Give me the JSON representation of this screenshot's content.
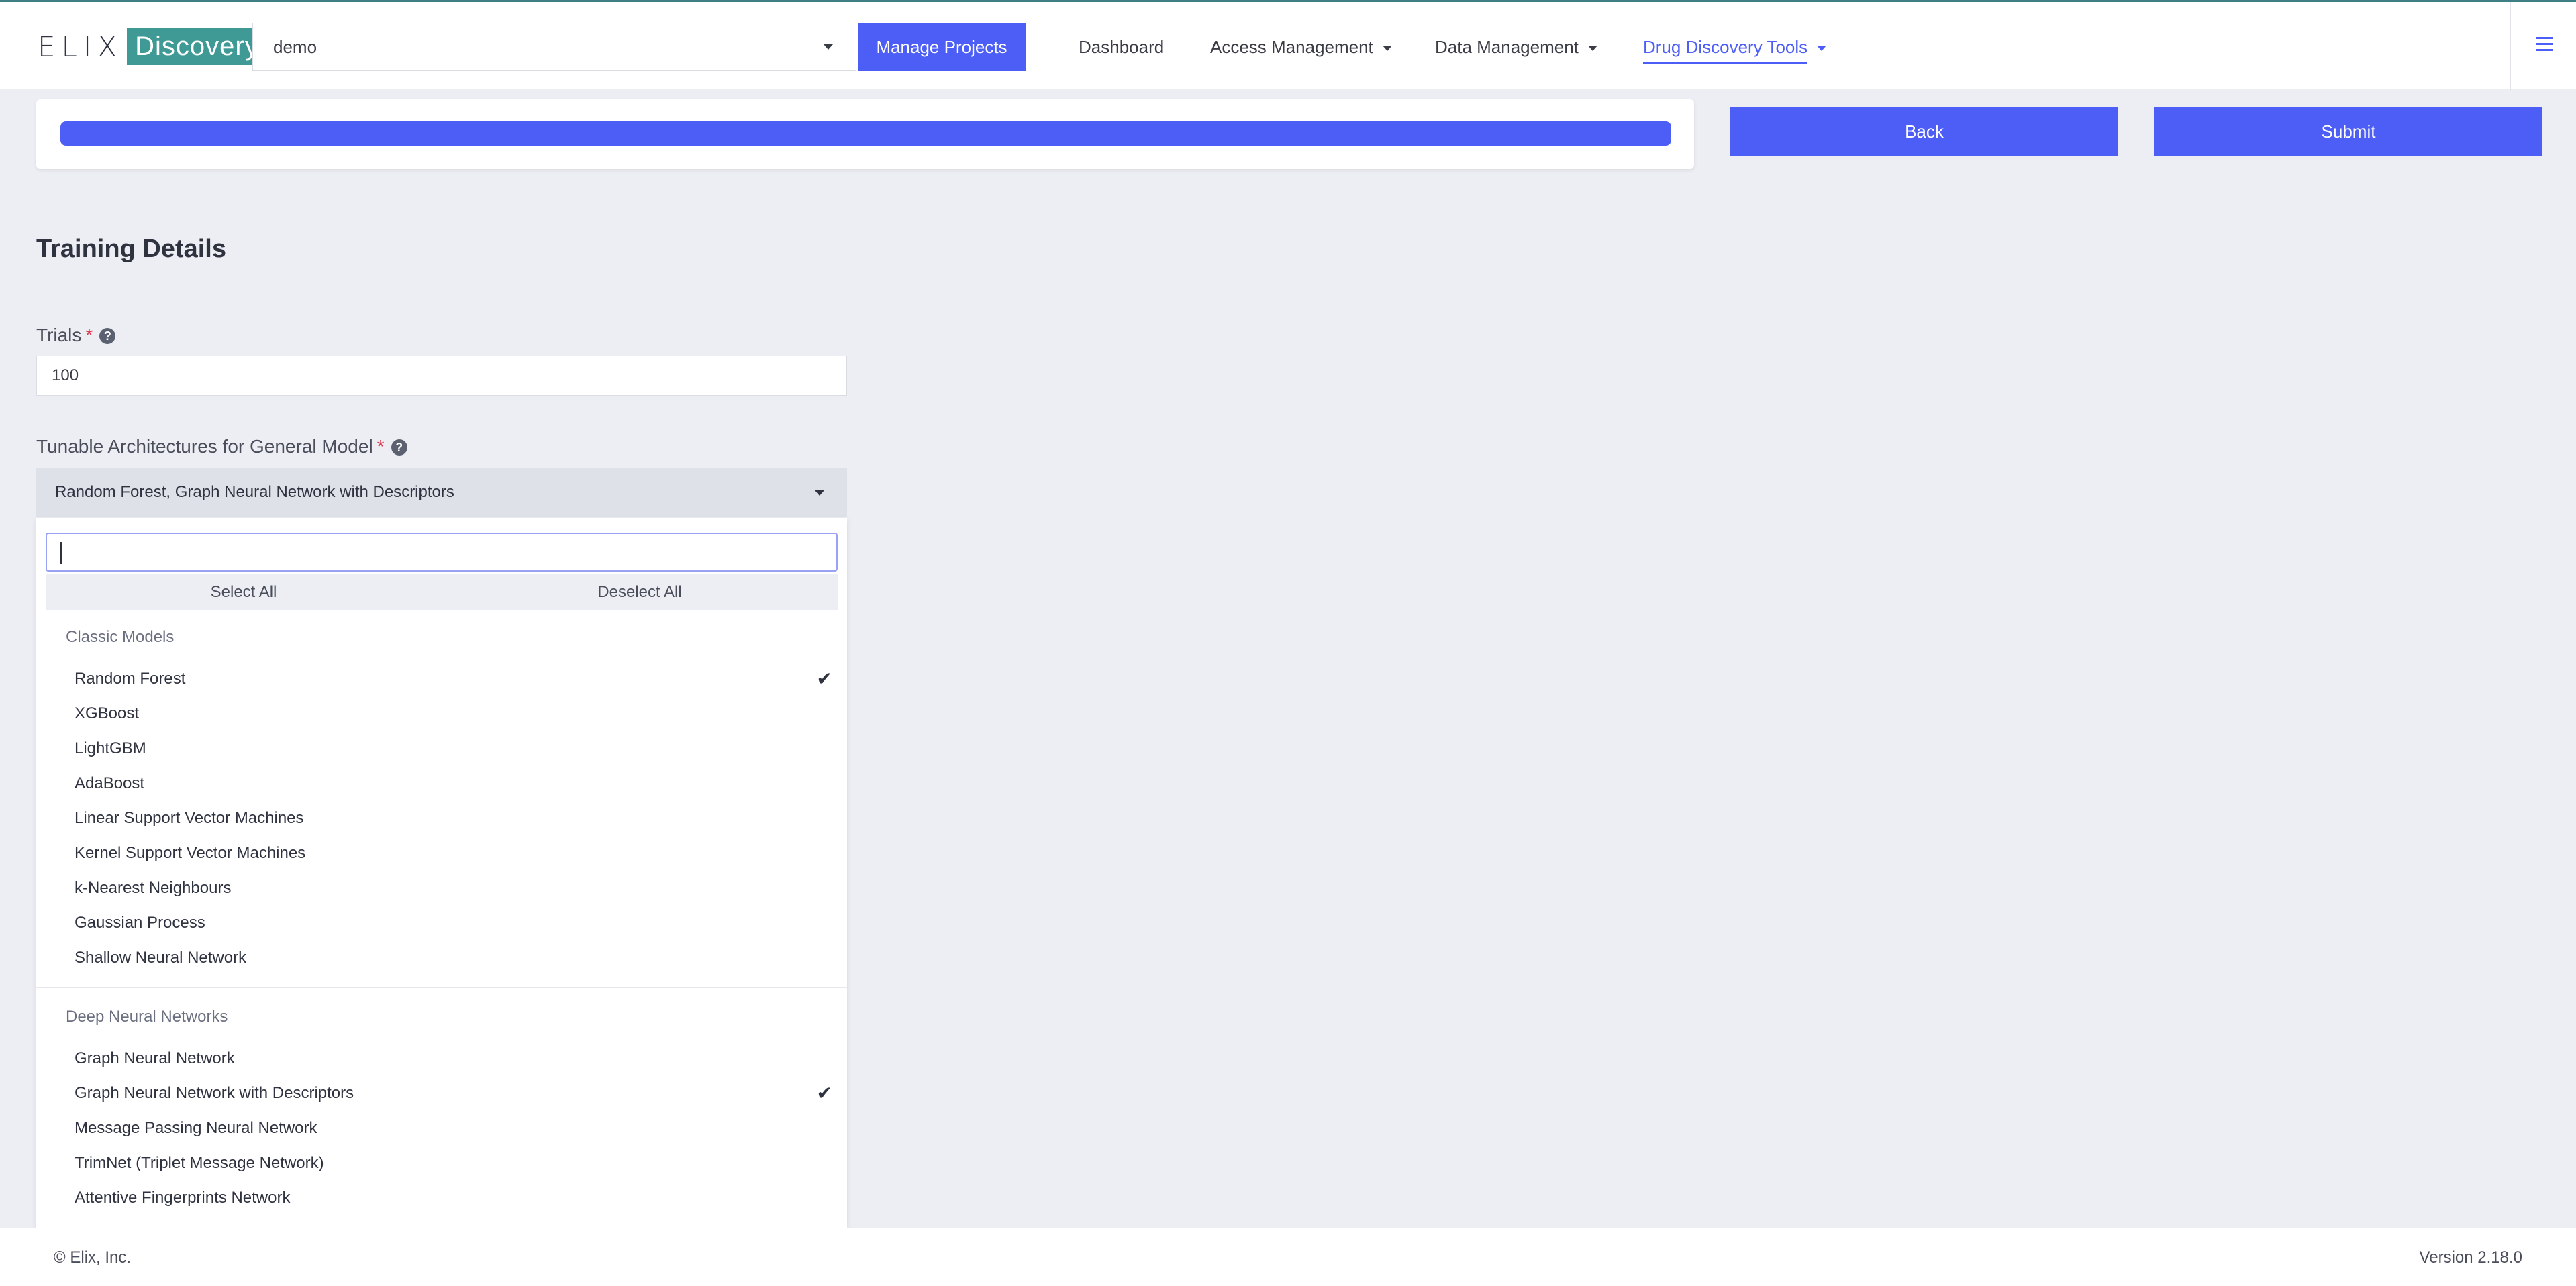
{
  "brand": {
    "name_part1": "ELIX",
    "name_part2": "Discovery",
    "mark": "®"
  },
  "header": {
    "project_value": "demo",
    "manage_projects": "Manage Projects",
    "nav": [
      {
        "label": "Dashboard"
      },
      {
        "label": "Access Management"
      },
      {
        "label": "Data Management"
      },
      {
        "label": "Drug Discovery Tools"
      }
    ]
  },
  "progress": {
    "percent": 100
  },
  "actions": {
    "back": "Back",
    "submit": "Submit"
  },
  "form": {
    "section_title": "Training Details",
    "trials": {
      "label": "Trials",
      "required_mark": "*",
      "help": "?",
      "value": "100"
    },
    "architectures": {
      "label": "Tunable Architectures for General Model",
      "required_mark": "*",
      "help": "?",
      "value": "Random Forest, Graph Neural Network with Descriptors"
    }
  },
  "dropdown": {
    "search_value": "",
    "select_all": "Select All",
    "deselect_all": "Deselect All",
    "check_glyph": "✔",
    "groups": [
      {
        "label": "Classic Models",
        "options": [
          {
            "label": "Random Forest",
            "selected": true
          },
          {
            "label": "XGBoost",
            "selected": false
          },
          {
            "label": "LightGBM",
            "selected": false
          },
          {
            "label": "AdaBoost",
            "selected": false
          },
          {
            "label": "Linear Support Vector Machines",
            "selected": false
          },
          {
            "label": "Kernel Support Vector Machines",
            "selected": false
          },
          {
            "label": "k-Nearest Neighbours",
            "selected": false
          },
          {
            "label": "Gaussian Process",
            "selected": false
          },
          {
            "label": "Shallow Neural Network",
            "selected": false
          }
        ]
      },
      {
        "label": "Deep Neural Networks",
        "options": [
          {
            "label": "Graph Neural Network",
            "selected": false
          },
          {
            "label": "Graph Neural Network with Descriptors",
            "selected": true
          },
          {
            "label": "Message Passing Neural Network",
            "selected": false
          },
          {
            "label": "TrimNet (Triplet Message Network)",
            "selected": false
          },
          {
            "label": "Attentive Fingerprints Network",
            "selected": false
          }
        ]
      }
    ]
  },
  "footer": {
    "copyright": "© Elix, Inc.",
    "version": "Version 2.18.0"
  },
  "colors": {
    "accent": "#4c5ef5",
    "brand_teal": "#3f9a95",
    "required": "#e0394f",
    "background": "#eceef4"
  }
}
